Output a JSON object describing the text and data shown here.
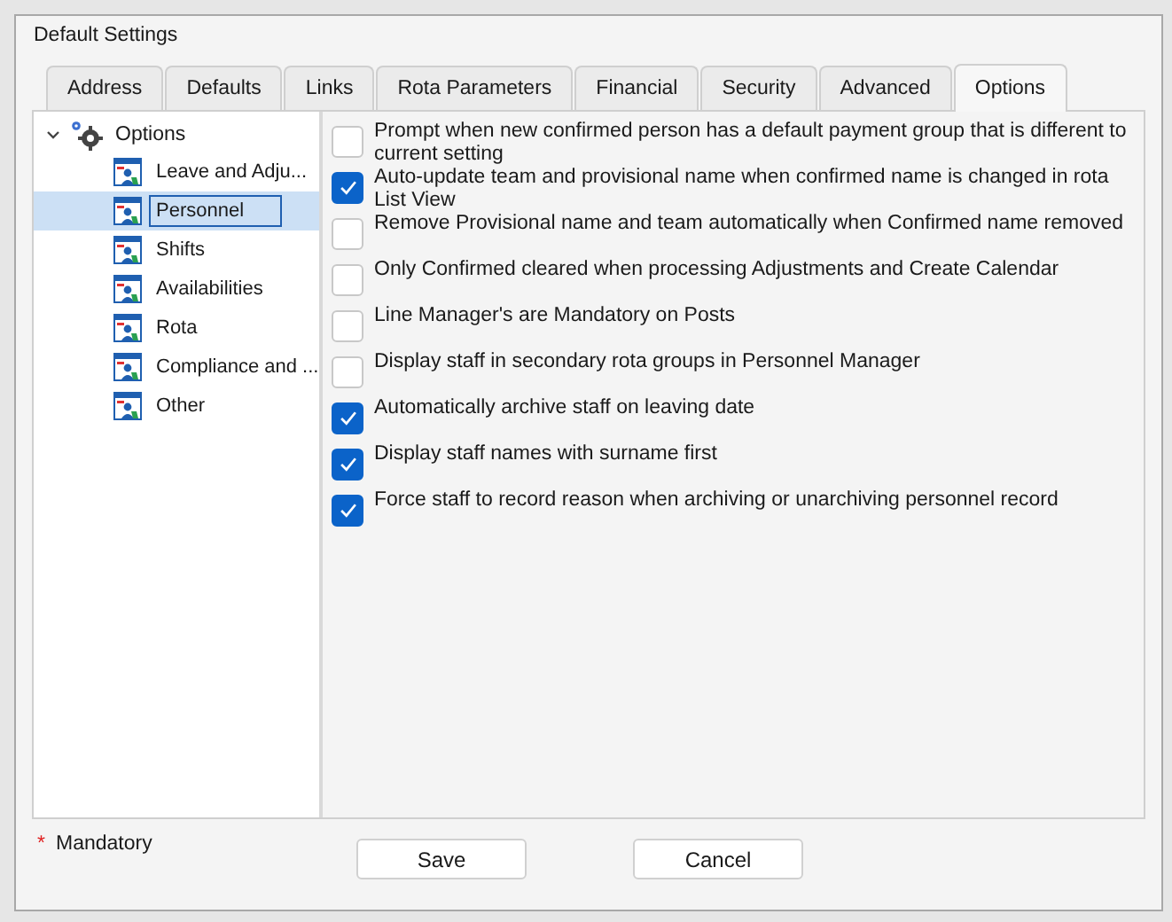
{
  "window": {
    "title": "Default Settings"
  },
  "tabs": [
    {
      "label": "Address",
      "selected": false
    },
    {
      "label": "Defaults",
      "selected": false
    },
    {
      "label": "Links",
      "selected": false
    },
    {
      "label": "Rota Parameters",
      "selected": false
    },
    {
      "label": "Financial",
      "selected": false
    },
    {
      "label": "Security",
      "selected": false
    },
    {
      "label": "Advanced",
      "selected": false
    },
    {
      "label": "Options",
      "selected": true
    }
  ],
  "tree": {
    "label": "Options",
    "expanded": true,
    "children": [
      {
        "label": "Leave and Adju...",
        "selected": false
      },
      {
        "label": "Personnel",
        "selected": true
      },
      {
        "label": "Shifts",
        "selected": false
      },
      {
        "label": "Availabilities",
        "selected": false
      },
      {
        "label": "Rota",
        "selected": false
      },
      {
        "label": "Compliance and ...",
        "selected": false
      },
      {
        "label": "Other",
        "selected": false
      }
    ]
  },
  "options": [
    {
      "label": "Prompt when new confirmed person has a default payment group that is different to current setting",
      "checked": false
    },
    {
      "label": "Auto-update team and provisional name when confirmed name is changed in rota List View",
      "checked": true
    },
    {
      "label": "Remove Provisional name and team automatically when Confirmed name removed",
      "checked": false
    },
    {
      "label": "Only Confirmed cleared when processing Adjustments and Create Calendar",
      "checked": false
    },
    {
      "label": "Line Manager's are Mandatory on Posts",
      "checked": false
    },
    {
      "label": "Display staff in secondary rota groups in Personnel Manager",
      "checked": false
    },
    {
      "label": "Automatically archive staff on leaving date",
      "checked": true
    },
    {
      "label": "Display staff names with surname first",
      "checked": true
    },
    {
      "label": "Force staff to record reason when archiving or unarchiving personnel record",
      "checked": true
    }
  ],
  "footer": {
    "required_mark": "*",
    "note": "Mandatory"
  },
  "buttons": [
    "Save",
    "Cancel"
  ]
}
